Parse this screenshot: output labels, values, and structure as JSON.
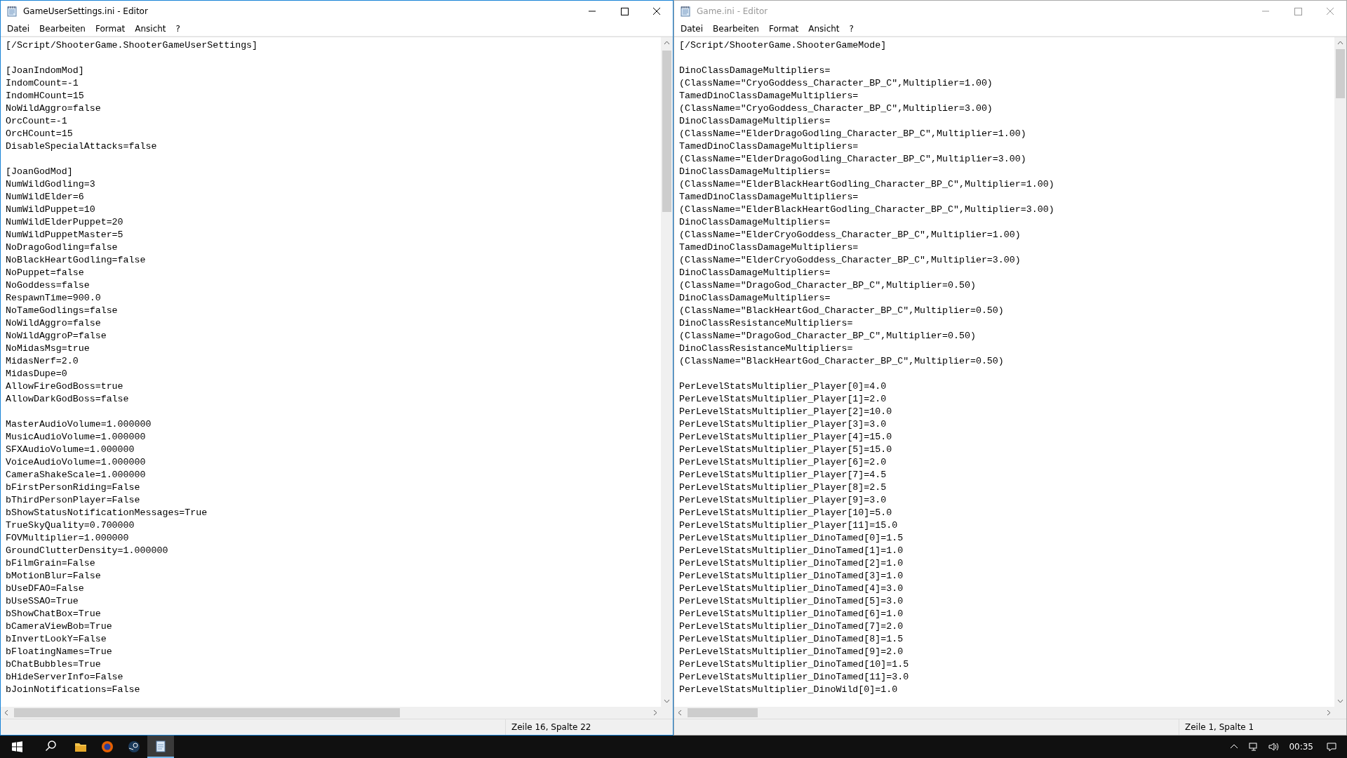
{
  "windows": [
    {
      "title": "GameUserSettings.ini - Editor",
      "active": true,
      "menu": [
        "Datei",
        "Bearbeiten",
        "Format",
        "Ansicht",
        "?"
      ],
      "status": "Zeile 16, Spalte 22",
      "blocks": [
        [
          "[/Script/ShooterGame.ShooterGameUserSettings]"
        ],
        [
          "[JoanIndomMod]",
          "IndomCount=-1",
          "IndomHCount=15",
          "NoWildAggro=false",
          "OrcCount=-1",
          "OrcHCount=15",
          "DisableSpecialAttacks=false"
        ],
        [
          "[JoanGodMod]",
          "NumWildGodling=3",
          "NumWildElder=6",
          "NumWildPuppet=10",
          "NumWildElderPuppet=20",
          "NumWildPuppetMaster=5",
          "NoDragoGodling=false",
          "NoBlackHeartGodling=false",
          "NoPuppet=false",
          "NoGoddess=false",
          "RespawnTime=900.0",
          "NoTameGodlings=false",
          "NoWildAggro=false",
          "NoWildAggroP=false",
          "NoMidasMsg=true",
          "MidasNerf=2.0",
          "MidasDupe=0",
          "AllowFireGodBoss=true",
          "AllowDarkGodBoss=false"
        ],
        [
          "MasterAudioVolume=1.000000",
          "MusicAudioVolume=1.000000",
          "SFXAudioVolume=1.000000",
          "VoiceAudioVolume=1.000000",
          "CameraShakeScale=1.000000",
          "bFirstPersonRiding=False",
          "bThirdPersonPlayer=False",
          "bShowStatusNotificationMessages=True",
          "TrueSkyQuality=0.700000",
          "FOVMultiplier=1.000000",
          "GroundClutterDensity=1.000000",
          "bFilmGrain=False",
          "bMotionBlur=False",
          "bUseDFAO=False",
          "bUseSSAO=True",
          "bShowChatBox=True",
          "bCameraViewBob=True",
          "bInvertLookY=False",
          "bFloatingNames=True",
          "bChatBubbles=True",
          "bHideServerInfo=False",
          "bJoinNotifications=False"
        ]
      ]
    },
    {
      "title": "Game.ini - Editor",
      "active": false,
      "menu": [
        "Datei",
        "Bearbeiten",
        "Format",
        "Ansicht",
        "?"
      ],
      "status": "Zeile 1, Spalte 1",
      "blocks": [
        [
          "[/Script/ShooterGame.ShooterGameMode]"
        ],
        [
          "DinoClassDamageMultipliers=",
          "(ClassName=\"CryoGoddess_Character_BP_C\",Multiplier=1.00)",
          "TamedDinoClassDamageMultipliers=",
          "(ClassName=\"CryoGoddess_Character_BP_C\",Multiplier=3.00)",
          "DinoClassDamageMultipliers=",
          "(ClassName=\"ElderDragoGodling_Character_BP_C\",Multiplier=1.00)",
          "TamedDinoClassDamageMultipliers=",
          "(ClassName=\"ElderDragoGodling_Character_BP_C\",Multiplier=3.00)",
          "DinoClassDamageMultipliers=",
          "(ClassName=\"ElderBlackHeartGodling_Character_BP_C\",Multiplier=1.00)",
          "TamedDinoClassDamageMultipliers=",
          "(ClassName=\"ElderBlackHeartGodling_Character_BP_C\",Multiplier=3.00)",
          "DinoClassDamageMultipliers=",
          "(ClassName=\"ElderCryoGoddess_Character_BP_C\",Multiplier=1.00)",
          "TamedDinoClassDamageMultipliers=",
          "(ClassName=\"ElderCryoGoddess_Character_BP_C\",Multiplier=3.00)",
          "DinoClassDamageMultipliers=",
          "(ClassName=\"DragoGod_Character_BP_C\",Multiplier=0.50)",
          "DinoClassDamageMultipliers=",
          "(ClassName=\"BlackHeartGod_Character_BP_C\",Multiplier=0.50)",
          "DinoClassResistanceMultipliers=",
          "(ClassName=\"DragoGod_Character_BP_C\",Multiplier=0.50)",
          "DinoClassResistanceMultipliers=",
          "(ClassName=\"BlackHeartGod_Character_BP_C\",Multiplier=0.50)"
        ],
        [
          "PerLevelStatsMultiplier_Player[0]=4.0",
          "PerLevelStatsMultiplier_Player[1]=2.0",
          "PerLevelStatsMultiplier_Player[2]=10.0",
          "PerLevelStatsMultiplier_Player[3]=3.0",
          "PerLevelStatsMultiplier_Player[4]=15.0",
          "PerLevelStatsMultiplier_Player[5]=15.0",
          "PerLevelStatsMultiplier_Player[6]=2.0",
          "PerLevelStatsMultiplier_Player[7]=4.5",
          "PerLevelStatsMultiplier_Player[8]=2.5",
          "PerLevelStatsMultiplier_Player[9]=3.0",
          "PerLevelStatsMultiplier_Player[10]=5.0",
          "PerLevelStatsMultiplier_Player[11]=15.0",
          "PerLevelStatsMultiplier_DinoTamed[0]=1.5",
          "PerLevelStatsMultiplier_DinoTamed[1]=1.0",
          "PerLevelStatsMultiplier_DinoTamed[2]=1.0",
          "PerLevelStatsMultiplier_DinoTamed[3]=1.0",
          "PerLevelStatsMultiplier_DinoTamed[4]=3.0",
          "PerLevelStatsMultiplier_DinoTamed[5]=3.0",
          "PerLevelStatsMultiplier_DinoTamed[6]=1.0",
          "PerLevelStatsMultiplier_DinoTamed[7]=2.0",
          "PerLevelStatsMultiplier_DinoTamed[8]=1.5",
          "PerLevelStatsMultiplier_DinoTamed[9]=2.0",
          "PerLevelStatsMultiplier_DinoTamed[10]=1.5",
          "PerLevelStatsMultiplier_DinoTamed[11]=3.0",
          "PerLevelStatsMultiplier_DinoWild[0]=1.0"
        ]
      ]
    }
  ],
  "taskbar": {
    "apps": [
      {
        "kind": "explorer",
        "selected": false
      },
      {
        "kind": "browser",
        "selected": false
      },
      {
        "kind": "steam",
        "selected": false
      },
      {
        "kind": "notepad",
        "selected": true
      }
    ],
    "time": "00:35"
  }
}
